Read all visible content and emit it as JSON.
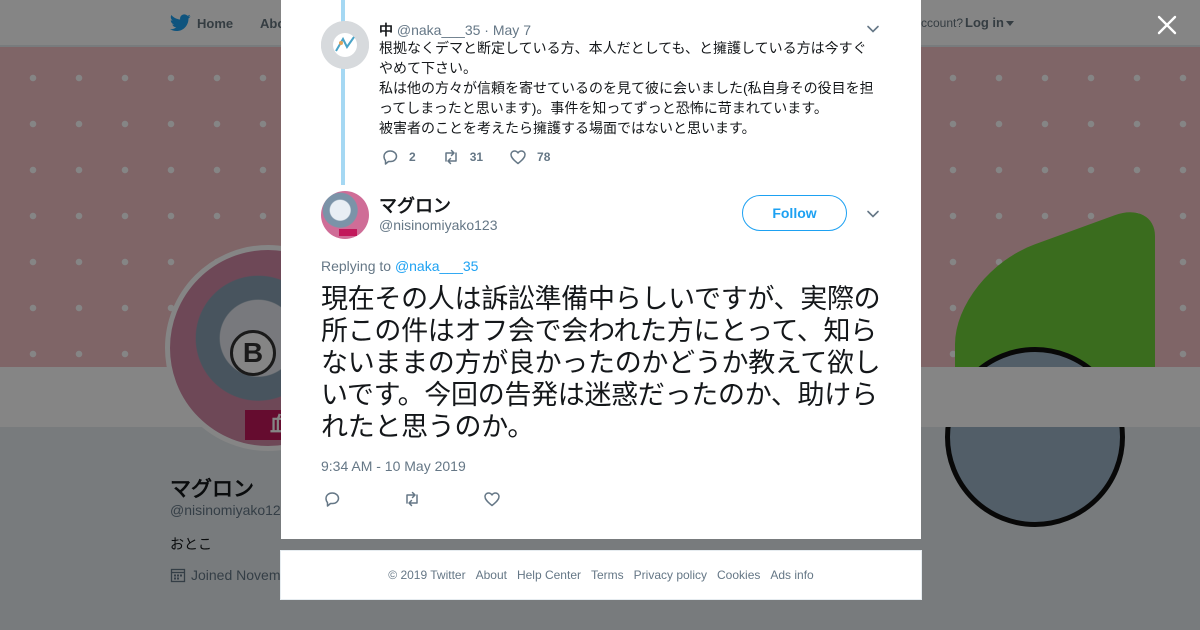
{
  "nav": {
    "home": "Home",
    "about": "Abo",
    "account_prompt": "ccount?",
    "login": "Log in"
  },
  "profile_bg": {
    "name": "マグロン",
    "handle": "@nisinomiyako12",
    "bio": "おとこ",
    "joined": "Joined Novem",
    "avatar_tag": "血"
  },
  "parent_tweet": {
    "name": "中",
    "handle": "@naka___35",
    "dot": "·",
    "date": "May 7",
    "lines": [
      "根拠なくデマと断定している方、本人だとしても、と擁護している方は今すぐやめて下さい。",
      "私は他の方々が信頼を寄せているのを見て彼に会いました(私自身その役目を担ってしまったと思います)。事件を知ってずっと恐怖に苛まれています。",
      "被害者のことを考えたら擁護する場面ではないと思います。"
    ],
    "reply_count": "2",
    "retweet_count": "31",
    "like_count": "78"
  },
  "main_tweet": {
    "name": "マグロン",
    "handle": "@nisinomiyako123",
    "follow_label": "Follow",
    "replying_prefix": "Replying to",
    "replying_to": "@naka___35",
    "text": "現在その人は訴訟準備中らしいですが、実際の所この件はオフ会で会われた方にとって、知らないままの方が良かったのかどうか教えて欲しいです。今回の告発は迷惑だったのか、助けられたと思うのか。",
    "timestamp": "9:34 AM - 10 May 2019"
  },
  "footer": {
    "copyright": "© 2019 Twitter",
    "links": [
      "About",
      "Help Center",
      "Terms",
      "Privacy policy",
      "Cookies",
      "Ads info"
    ]
  },
  "colors": {
    "brand": "#1da1f2",
    "thread_line": "#a5d8f3",
    "muted": "#657786"
  },
  "icons": [
    "twitter-bird-icon",
    "close-icon",
    "chevron-down-icon",
    "reply-icon",
    "retweet-icon",
    "like-icon",
    "calendar-icon"
  ]
}
